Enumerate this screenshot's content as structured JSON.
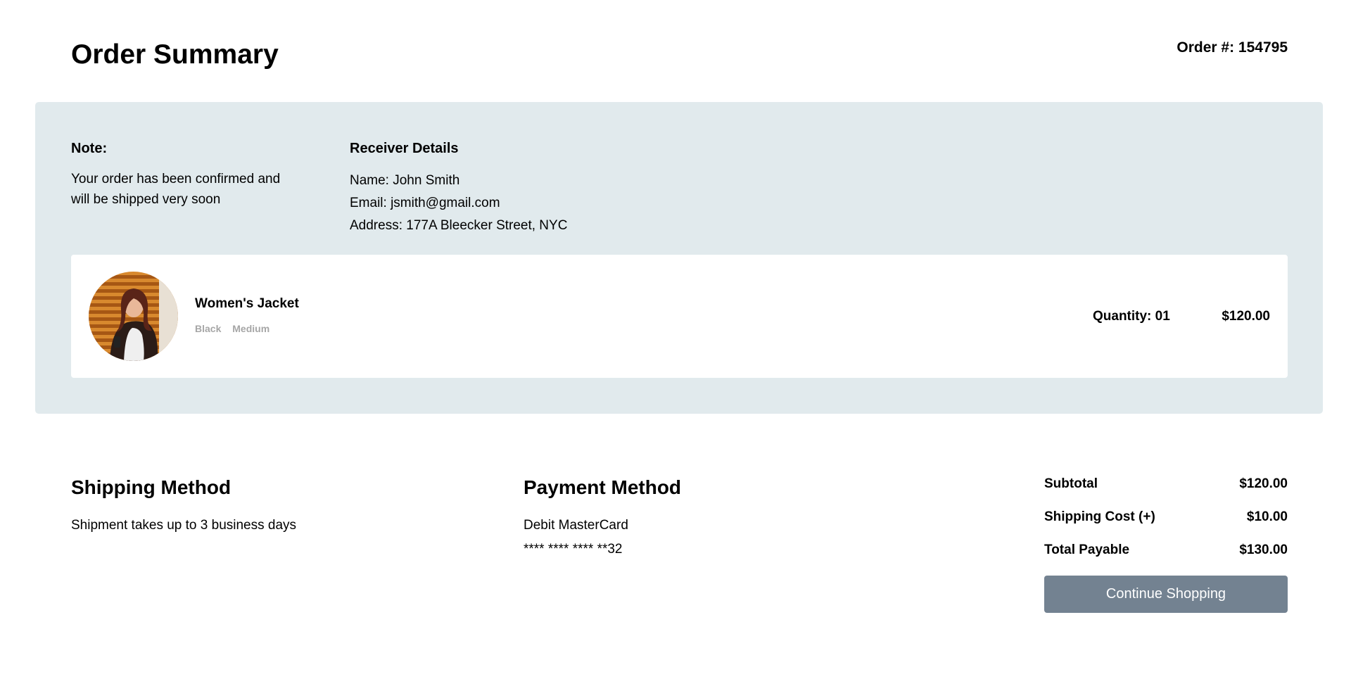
{
  "header": {
    "title": "Order Summary",
    "order_number": "Order #: 154795"
  },
  "note": {
    "heading": "Note:",
    "text": "Your order has been confirmed and will be shipped very soon"
  },
  "receiver": {
    "heading": "Receiver Details",
    "name": "Name: John Smith",
    "email": "Email: jsmith@gmail.com",
    "address": "Address: 177A Bleecker Street, NYC"
  },
  "item": {
    "name": "Women's Jacket",
    "color": "Black",
    "size": "Medium",
    "quantity": "Quantity: 01",
    "price": "$120.00"
  },
  "shipping": {
    "heading": "Shipping Method",
    "text": "Shipment takes up to 3 business days"
  },
  "payment": {
    "heading": "Payment Method",
    "card_type": "Debit MasterCard",
    "card_number": "**** **** **** **32"
  },
  "totals": {
    "subtotal_label": "Subtotal",
    "subtotal_value": "$120.00",
    "shipping_label": "Shipping Cost (+)",
    "shipping_value": "$10.00",
    "total_label": "Total Payable",
    "total_value": "$130.00"
  },
  "actions": {
    "continue_label": "Continue Shopping"
  },
  "colors": {
    "panel_background": "#e1eaed",
    "button_background": "#738291",
    "variant_text": "#a6a6a6"
  }
}
